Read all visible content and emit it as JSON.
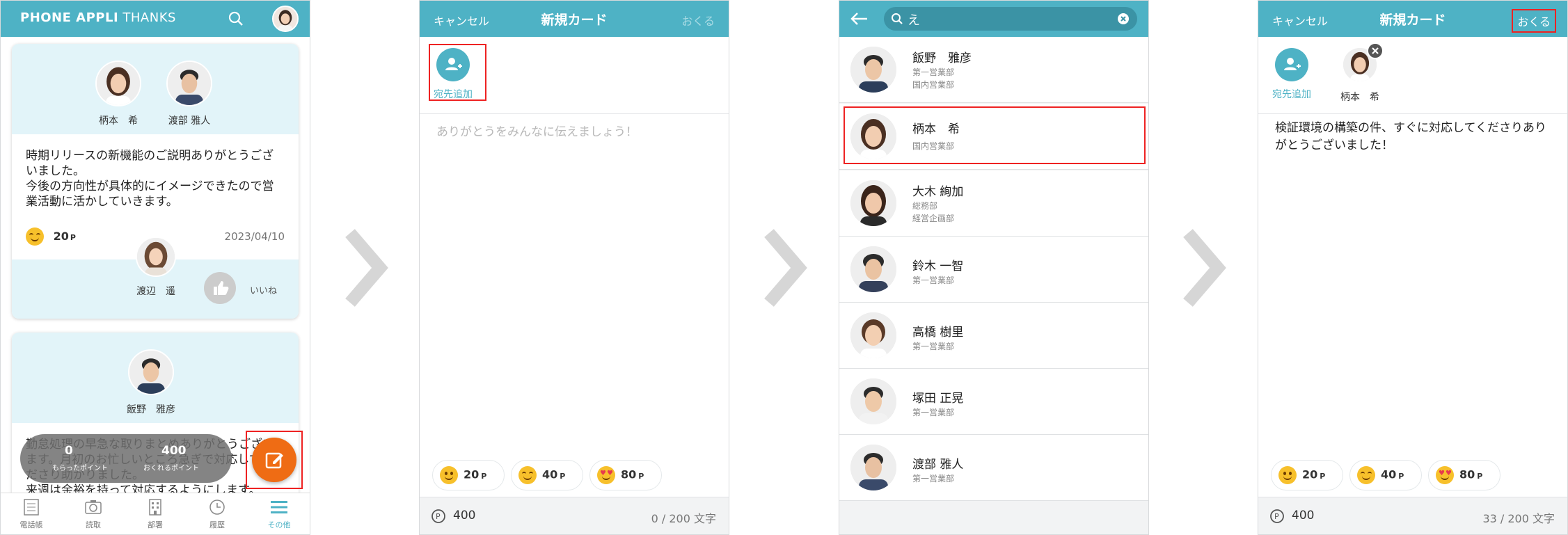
{
  "panel1": {
    "brand_bold": "PHONE APPLI",
    "brand_light": " THANKS",
    "card1": {
      "recipients": [
        "柄本　希",
        "渡部 雅人"
      ],
      "message": "時期リリースの新機能のご説明ありがとうございました。\n今後の方向性が具体的にイメージできたので営業活動に活かしていきます。",
      "points": "20",
      "points_unit": "P",
      "date": "2023/04/10",
      "sender": "渡辺　遥",
      "like_label": "いいね"
    },
    "card2": {
      "recipient": "飯野　雅彦",
      "message": "勤怠処理の早急な取りまとめありがとうございます。月初のお忙しいところ急ぎで対応してくださり助かりました。\n来週は余裕を持って対応するようにします。"
    },
    "points_pill": {
      "received_value": "0",
      "received_label": "もらったポイント",
      "giveable_value": "400",
      "giveable_label": "おくれるポイント"
    },
    "tabs": [
      {
        "label": "電話帳",
        "icon": "phonebook-icon"
      },
      {
        "label": "読取",
        "icon": "camera-icon"
      },
      {
        "label": "部署",
        "icon": "building-icon"
      },
      {
        "label": "履歴",
        "icon": "clock-icon"
      },
      {
        "label": "その他",
        "icon": "menu-icon"
      }
    ],
    "accent": "#4eb2c5",
    "fab_color": "#ef6c14"
  },
  "panel2": {
    "cancel": "キャンセル",
    "title": "新規カード",
    "send": "おくる",
    "add_recipient": "宛先追加",
    "placeholder": "ありがとうをみんなに伝えましょう！",
    "stamps": [
      {
        "value": "20",
        "unit": "P"
      },
      {
        "value": "40",
        "unit": "P"
      },
      {
        "value": "80",
        "unit": "P"
      }
    ],
    "points": "400",
    "char_count": "0 / 200 文字"
  },
  "panel3": {
    "search_query": "え",
    "people": [
      {
        "name": "飯野　雅彦",
        "dept1": "第一営業部",
        "dept2": "国内営業部"
      },
      {
        "name": "柄本　希",
        "dept1": "国内営業部",
        "dept2": ""
      },
      {
        "name": "大木 絢加",
        "dept1": "総務部",
        "dept2": "経営企画部"
      },
      {
        "name": "鈴木 一智",
        "dept1": "第一営業部",
        "dept2": ""
      },
      {
        "name": "高橋 樹里",
        "dept1": "第一営業部",
        "dept2": ""
      },
      {
        "name": "塚田 正晃",
        "dept1": "第一営業部",
        "dept2": ""
      },
      {
        "name": "渡部 雅人",
        "dept1": "第一営業部",
        "dept2": ""
      }
    ]
  },
  "panel4": {
    "cancel": "キャンセル",
    "title": "新規カード",
    "send": "おくる",
    "add_recipient": "宛先追加",
    "selected_recipient": "柄本　希",
    "message": "検証環境の構築の件、すぐに対応してくださりありがとうございました！",
    "stamps": [
      {
        "value": "20",
        "unit": "P"
      },
      {
        "value": "40",
        "unit": "P"
      },
      {
        "value": "80",
        "unit": "P"
      }
    ],
    "points": "400",
    "char_count": "33 / 200 文字"
  }
}
